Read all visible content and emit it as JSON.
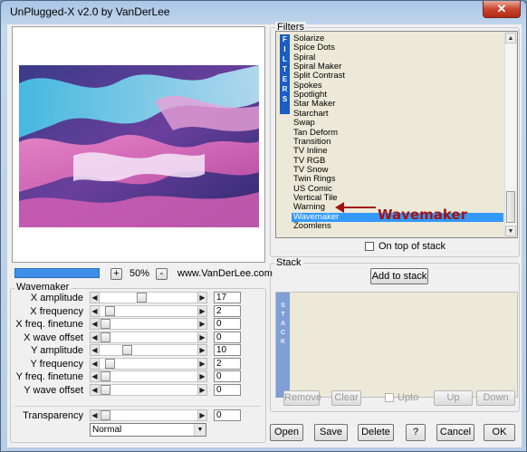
{
  "window": {
    "title": "UnPlugged-X v2.0 by VanDerLee",
    "close_glyph": "✕"
  },
  "preview": {
    "zoom_minus": "-",
    "zoom_plus": "+",
    "zoom_level": "50%",
    "website": "www.VanDerLee.com",
    "progress": 1.0
  },
  "params": {
    "group_title": "Wavemaker",
    "rows": [
      {
        "label": "X amplitude",
        "value": "17",
        "level": 0.17
      },
      {
        "label": "X frequency",
        "value": "2",
        "level": 0.02
      },
      {
        "label": "X freq. finetune",
        "value": "0",
        "level": 0.0
      },
      {
        "label": "X wave offset",
        "value": "0",
        "level": 0.0
      },
      {
        "label": "Y amplitude",
        "value": "10",
        "level": 0.1
      },
      {
        "label": "Y frequency",
        "value": "2",
        "level": 0.02
      },
      {
        "label": "Y freq. finetune",
        "value": "0",
        "level": 0.0
      },
      {
        "label": "Y wave offset",
        "value": "0",
        "level": 0.0
      }
    ],
    "transparency": {
      "label": "Transparency",
      "value": "0",
      "level": 0.0
    },
    "blend_mode": "Normal"
  },
  "filters": {
    "group_title": "Filters",
    "tab_label": "FILTERS",
    "items": [
      "Solarize",
      "Spice Dots",
      "Spiral",
      "Spiral Maker",
      "Split Contrast",
      "Spokes",
      "Spotlight",
      "Star Maker",
      "Starchart",
      "Swap",
      "Tan Deform",
      "Transition",
      "TV Inline",
      "TV RGB",
      "TV Snow",
      "Twin Rings",
      "US Comic",
      "Vertical Tile",
      "Warning",
      "Wavemaker",
      "Zoomlens"
    ],
    "selected_index": 19,
    "on_top_label": "On top of stack",
    "annotation": "Wavemaker"
  },
  "stack": {
    "group_title": "Stack",
    "add_label": "Add to stack",
    "tab_label": "STACK",
    "remove_label": "Remove",
    "clear_label": "Clear",
    "upto_label": "Upto",
    "up_label": "Up",
    "down_label": "Down"
  },
  "footer": {
    "open_label": "Open",
    "save_label": "Save",
    "delete_label": "Delete",
    "help_label": "?",
    "cancel_label": "Cancel",
    "ok_label": "OK"
  },
  "colors": {
    "accent": "#3399ff",
    "filter_tab": "#1a5dc3",
    "annotation": "#a31313",
    "progress": "#3d8ee6"
  },
  "icons": {
    "close": "close-icon",
    "arrow_left": "arrow-left-icon",
    "arrow_right": "arrow-right-icon",
    "dropdown": "chevron-down-icon"
  }
}
